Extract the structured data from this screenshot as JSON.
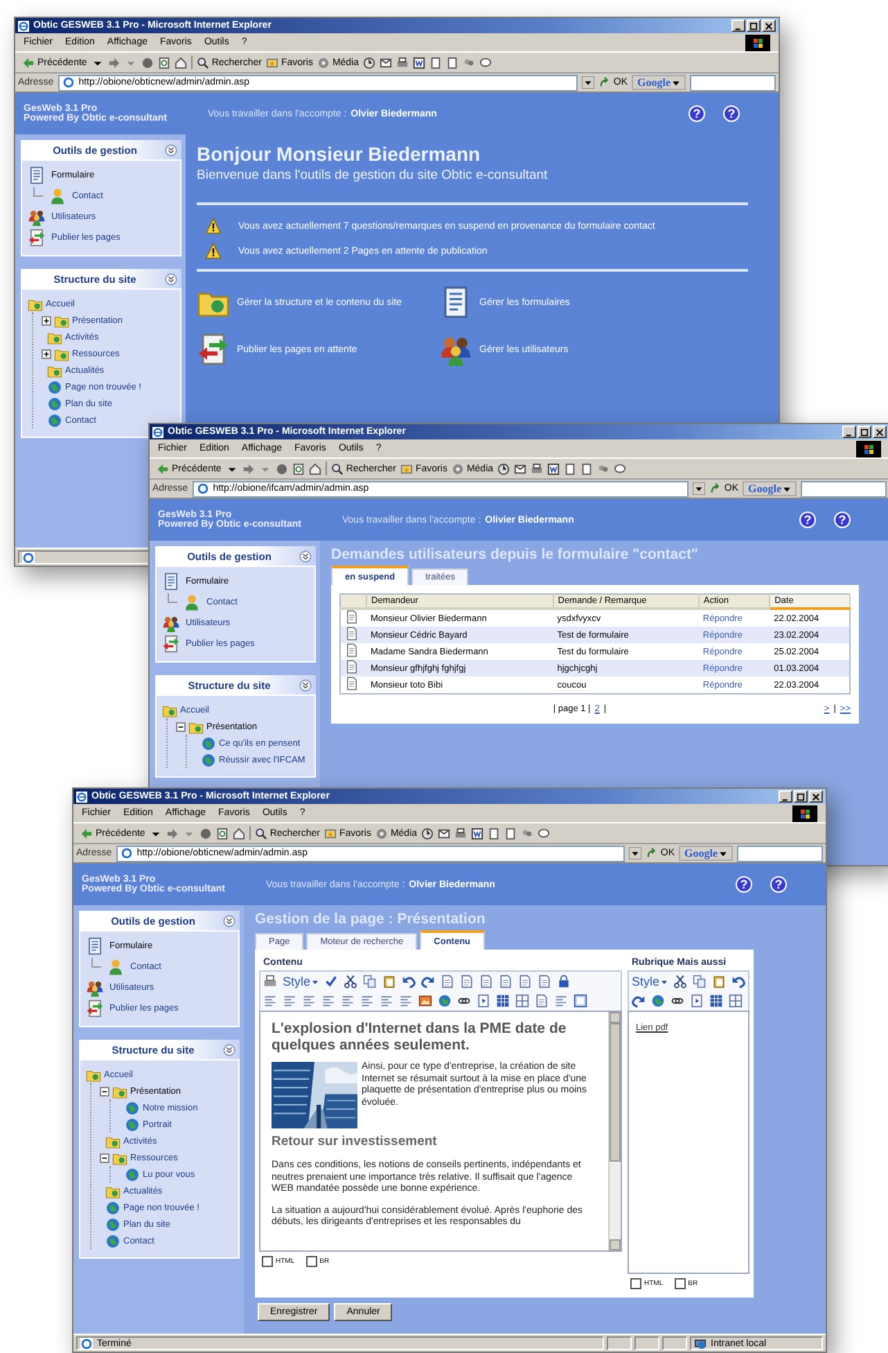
{
  "windows": [
    {
      "title": "Obtic GESWEB 3.1 Pro - Microsoft Internet Explorer",
      "menu": [
        "Fichier",
        "Edition",
        "Affichage",
        "Favoris",
        "Outils",
        "?"
      ],
      "toolbar": {
        "back": "Précédente",
        "search": "Rechercher",
        "favorites": "Favoris",
        "media": "Média"
      },
      "address_label": "Adresse",
      "address": "http://obione/obticnew/admin/admin.asp",
      "go": "OK",
      "search_engine": "Google",
      "brand": "GesWeb 3.1 Pro",
      "tagline": "Powered By Obtic e-consultant",
      "account_label": "Vous travailler dans l'accompte :",
      "account_name": "Olvier Biedermann",
      "help": [
        "?",
        "?"
      ],
      "tools_panel": {
        "title": "Outils de gestion",
        "items": [
          {
            "label": "Formulaire",
            "kind": "form",
            "children": [
              {
                "label": "Contact",
                "kind": "user"
              }
            ]
          },
          {
            "label": "Utilisateurs",
            "kind": "users"
          },
          {
            "label": "Publier les pages",
            "kind": "publish"
          }
        ]
      },
      "structure_panel": {
        "title": "Structure du site",
        "tree": [
          {
            "label": "Accueil",
            "kind": "folder",
            "selected": false,
            "children": [
              {
                "label": "Présentation",
                "kind": "folder",
                "expanded": false,
                "selected": false
              },
              {
                "label": "Activités",
                "kind": "folder",
                "selected": false
              },
              {
                "label": "Ressources",
                "kind": "folder",
                "expanded": false,
                "selected": false
              },
              {
                "label": "Actualités",
                "kind": "folder",
                "selected": false
              },
              {
                "label": "Page non trouvée !",
                "kind": "page",
                "selected": false
              },
              {
                "label": "Plan du site",
                "kind": "page",
                "selected": false
              },
              {
                "label": "Contact",
                "kind": "page",
                "selected": false
              }
            ]
          }
        ]
      },
      "content": {
        "kind": "home",
        "title": "Bonjour Monsieur Biedermann",
        "subtitle": "Bienvenue dans l'outils de gestion du site Obtic e-consultant",
        "alerts": [
          "Vous avez actuellement 7 questions/remarques en suspend en provenance du formulaire contact",
          "Vous avez actuellement 2 Pages en attente de publication"
        ],
        "actions": [
          {
            "label": "Gérer la structure et le contenu du site",
            "kind": "folder"
          },
          {
            "label": "Gérer les formulaires",
            "kind": "form"
          },
          {
            "label": "Publier les pages en attente",
            "kind": "publish"
          },
          {
            "label": "Gérer les utilisateurs",
            "kind": "users"
          }
        ]
      },
      "status": {
        "icon": true
      }
    },
    {
      "title": "Obtic GESWEB 3.1 Pro - Microsoft Internet Explorer",
      "menu": [
        "Fichier",
        "Edition",
        "Affichage",
        "Favoris",
        "Outils",
        "?"
      ],
      "toolbar": {
        "back": "Précédente",
        "search": "Rechercher",
        "favorites": "Favoris",
        "media": "Média"
      },
      "address_label": "Adresse",
      "address": "http://obione/ifcam/admin/admin.asp",
      "go": "OK",
      "search_engine": "Google",
      "brand": "GesWeb 3.1 Pro",
      "tagline": "Powered By Obtic e-consultant",
      "account_label": "Vous travailler dans l'accompte :",
      "account_name": "Olivier Biedermann",
      "help": [
        "?",
        "?"
      ],
      "tools_panel": {
        "title": "Outils de gestion",
        "items": [
          {
            "label": "Formulaire",
            "kind": "form",
            "children": [
              {
                "label": "Contact",
                "kind": "user"
              }
            ]
          },
          {
            "label": "Utilisateurs",
            "kind": "users"
          },
          {
            "label": "Publier les pages",
            "kind": "publish"
          }
        ]
      },
      "structure_panel": {
        "title": "Structure du site",
        "tree": [
          {
            "label": "Accueil",
            "kind": "folder",
            "selected": false,
            "children": [
              {
                "label": "Présentation",
                "kind": "folder",
                "expanded": true,
                "selected": true,
                "children": [
                  {
                    "label": "Ce qu'ils en pensent",
                    "kind": "page",
                    "selected": false
                  },
                  {
                    "label": "Réussir avec l'IFCAM",
                    "kind": "page",
                    "selected": false
                  }
                ]
              }
            ]
          }
        ]
      },
      "content": {
        "kind": "requests",
        "title": "Demandes utilisateurs depuis le formulaire \"contact\"",
        "tabs": [
          {
            "label": "en suspend",
            "selected": true
          },
          {
            "label": "traitées",
            "selected": false
          }
        ],
        "columns": [
          {
            "label": "Demandeur",
            "sorted": false
          },
          {
            "label": "Demande / Remarque",
            "sorted": false
          },
          {
            "label": "Action",
            "sorted": false
          },
          {
            "label": "Date",
            "sorted": true
          }
        ],
        "rows": [
          {
            "name": "Monsieur Olivier Biedermann",
            "request": "ysdxfvyxcv",
            "action": "Répondre",
            "date": "22.02.2004"
          },
          {
            "name": "Monsieur Cédric Bayard",
            "request": "Test de formulaire",
            "action": "Répondre",
            "date": "23.02.2004"
          },
          {
            "name": "Madame Sandra Biedermann",
            "request": "Test du formulaire",
            "action": "Répondre",
            "date": "25.02.2004"
          },
          {
            "name": "Monsieur gfhjfghj fghjfgj",
            "request": "hjgchjcghj",
            "action": "Répondre",
            "date": "01.03.2004"
          },
          {
            "name": "Monsieur toto Bibi",
            "request": "coucou",
            "action": "Répondre",
            "date": "22.03.2004"
          }
        ],
        "pager": [
          {
            "text": "| page 1 |",
            "link": false
          },
          {
            "text": "2",
            "link": true
          },
          {
            "text": "|",
            "link": false
          }
        ],
        "nav": [
          {
            "text": ">",
            "link": true
          },
          {
            "text": "|",
            "link": false
          },
          {
            "text": ">>",
            "link": true
          }
        ]
      }
    },
    {
      "title": "Obtic GESWEB 3.1 Pro - Microsoft Internet Explorer",
      "menu": [
        "Fichier",
        "Edition",
        "Affichage",
        "Favoris",
        "Outils",
        "?"
      ],
      "toolbar": {
        "back": "Précédente",
        "search": "Rechercher",
        "favorites": "Favoris",
        "media": "Média"
      },
      "address_label": "Adresse",
      "address": "http://obione/obticnew/admin/admin.asp",
      "go": "OK",
      "search_engine": "Google",
      "brand": "GesWeb 3.1 Pro",
      "tagline": "Powered By Obtic e-consultant",
      "account_label": "Vous travailler dans l'accompte :",
      "account_name": "Olvier Biedermann",
      "help": [
        "?",
        "?"
      ],
      "tools_panel": {
        "title": "Outils de gestion",
        "items": [
          {
            "label": "Formulaire",
            "kind": "form",
            "children": [
              {
                "label": "Contact",
                "kind": "user"
              }
            ]
          },
          {
            "label": "Utilisateurs",
            "kind": "users"
          },
          {
            "label": "Publier les pages",
            "kind": "publish"
          }
        ]
      },
      "structure_panel": {
        "title": "Structure du site",
        "tree": [
          {
            "label": "Accueil",
            "kind": "folder",
            "selected": false,
            "children": [
              {
                "label": "Présentation",
                "kind": "folder",
                "expanded": true,
                "selected": true,
                "children": [
                  {
                    "label": "Notre mission",
                    "kind": "page",
                    "selected": false
                  },
                  {
                    "label": "Portrait",
                    "kind": "page",
                    "selected": false
                  }
                ]
              },
              {
                "label": "Activités",
                "kind": "folder",
                "selected": false
              },
              {
                "label": "Ressources",
                "kind": "folder",
                "expanded": true,
                "selected": false,
                "children": [
                  {
                    "label": "Lu pour vous",
                    "kind": "page",
                    "selected": false
                  }
                ]
              },
              {
                "label": "Actualités",
                "kind": "folder",
                "selected": false
              },
              {
                "label": "Page non trouvée !",
                "kind": "page",
                "selected": false
              },
              {
                "label": "Plan du site",
                "kind": "page",
                "selected": false
              },
              {
                "label": "Contact",
                "kind": "page",
                "selected": false
              }
            ]
          }
        ]
      },
      "content": {
        "kind": "editor",
        "title": "Gestion de la page : Présentation",
        "tabs": [
          {
            "label": "Page",
            "selected": false
          },
          {
            "label": "Moteur de recherche",
            "selected": false
          },
          {
            "label": "Contenu",
            "selected": true
          }
        ],
        "main": {
          "label": "Contenu",
          "style": "Style",
          "heading": "L'explosion d'Internet dans la PME date de quelques années seulement.",
          "intro": "Ainsi, pour ce type d'entreprise, la création de site Internet se résumait surtout à la mise en place d'une plaquette de présentation d'entreprise plus ou moins évoluée.",
          "subheading": "Retour sur investissement",
          "paragraphs": [
            "Dans ces conditions, les notions de conseils pertinents, indépendants et neutres prenaient une importance très relative. Il suffisait que l'agence WEB mandatée possède une bonne expérience.",
            "La situation a aujourd'hui considérablement évolué. Après l'euphorie des débuts, les dirigeants d'entreprises et les responsables du"
          ],
          "options": [
            {
              "label": "HTML",
              "checked": false
            },
            {
              "label": "BR",
              "checked": false
            }
          ]
        },
        "side": {
          "label": "Rubrique Mais aussi",
          "style": "Style",
          "link": "Lien pdf",
          "options": [
            {
              "label": "HTML",
              "checked": false
            },
            {
              "label": "BR",
              "checked": false
            }
          ]
        },
        "buttons": [
          "Enregistrer",
          "Annuler"
        ]
      },
      "status": {
        "icon": true,
        "text": "Terminé",
        "zone": "Intranet local"
      }
    }
  ]
}
